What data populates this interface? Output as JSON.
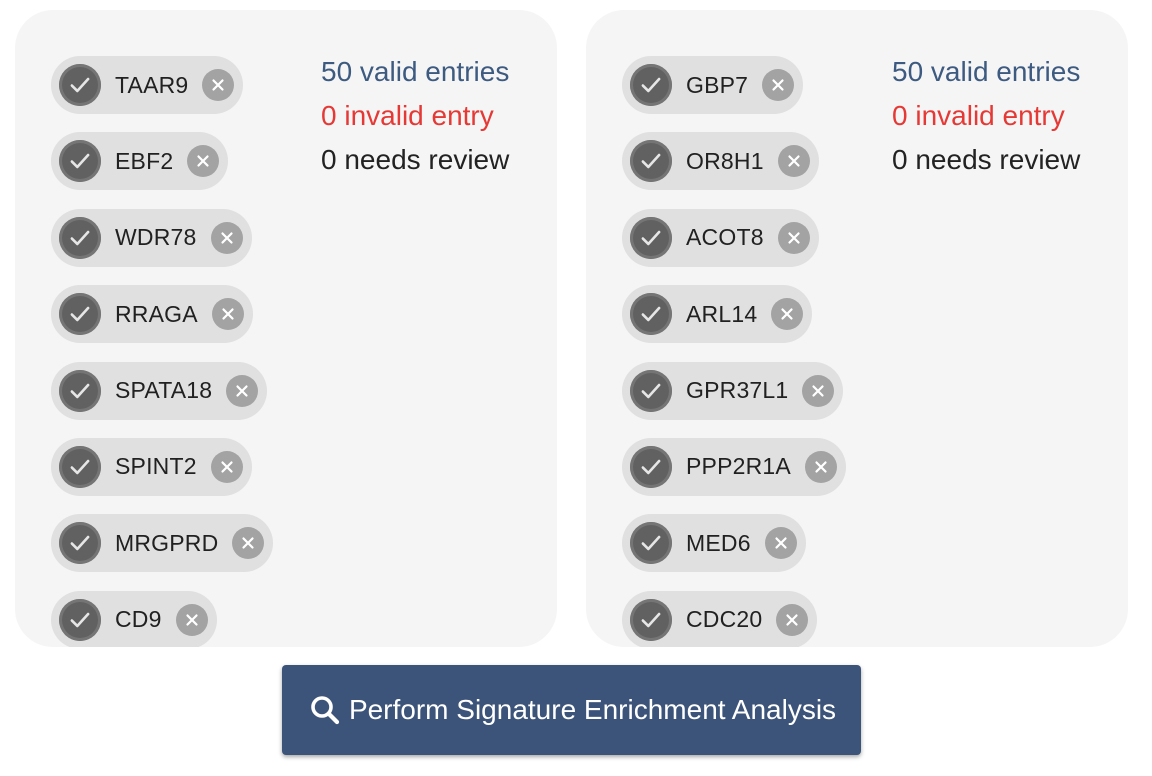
{
  "left_panel": {
    "genes": [
      "TAAR9",
      "EBF2",
      "WDR78",
      "RRAGA",
      "SPATA18",
      "SPINT2",
      "MRGPRD",
      "CD9"
    ],
    "stats": {
      "valid": "50 valid entries",
      "invalid": "0 invalid entry",
      "review": "0 needs review"
    }
  },
  "right_panel": {
    "genes": [
      "GBP7",
      "OR8H1",
      "ACOT8",
      "ARL14",
      "GPR37L1",
      "PPP2R1A",
      "MED6",
      "CDC20"
    ],
    "stats": {
      "valid": "50 valid entries",
      "invalid": "0 invalid entry",
      "review": "0 needs review"
    }
  },
  "action": {
    "label": "Perform Signature Enrichment Analysis",
    "icon": "search-icon"
  },
  "colors": {
    "valid": "#3d5a80",
    "invalid": "#e53935",
    "button": "#3c5479",
    "panel": "#f5f5f5",
    "chip": "#e0e0e0"
  }
}
